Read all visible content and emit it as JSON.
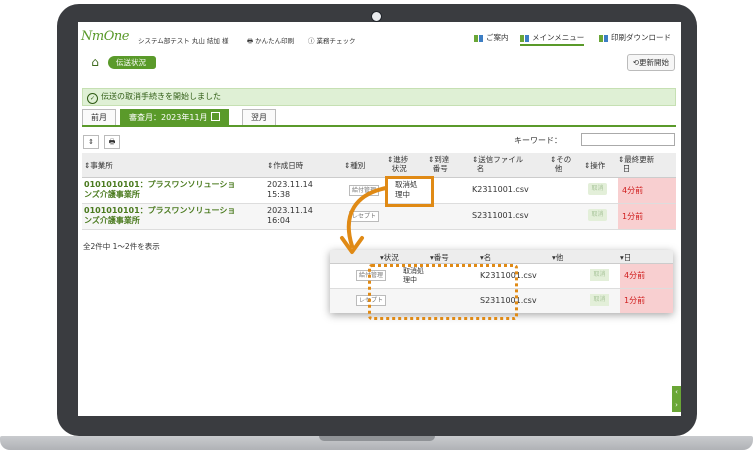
{
  "header": {
    "logo_text": "NmOne",
    "user_info": "システム部テスト 丸山 結加 様",
    "easy_print": "かんたん印刷",
    "task_check": "業務チェック",
    "nav": [
      "ご案内",
      "メインメニュー",
      "印刷ダウンロード"
    ]
  },
  "breadcrumb": {
    "label": "伝送状況"
  },
  "refresh_button": "更新開始",
  "notice": "伝送の取消手続きを開始しました",
  "tabs": {
    "prev": "前月",
    "current": "審査月：2023年11月",
    "next": "翌月"
  },
  "keyword": {
    "label": "キーワード：",
    "value": ""
  },
  "table": {
    "headers": {
      "office": "事業所",
      "created": "作成日時",
      "type": "種別",
      "progress_1": "進捗",
      "progress_2": "状況",
      "arrival_1": "到達",
      "arrival_2": "番号",
      "file_1": "送信ファイル",
      "file_2": "名",
      "other_1": "その",
      "other_2": "他",
      "action": "操作",
      "updated_1": "最終更新",
      "updated_2": "日"
    },
    "rows": [
      {
        "office_1": "0101010101：プラスワンソリューショ",
        "office_2": "ンズ介護事業所",
        "date_1": "2023.11.14",
        "date_2": "15:38",
        "type": "給付管理",
        "status_1": "取消処",
        "status_2": "理中",
        "file": "K2311001.csv",
        "cancel": "取消",
        "updated": "4分前"
      },
      {
        "office_1": "0101010101：プラスワンソリューショ",
        "office_2": "ンズ介護事業所",
        "date_1": "2023.11.14",
        "date_2": "16:04",
        "type": "レセプト",
        "status_1": "",
        "status_2": "",
        "file": "S2311001.csv",
        "cancel": "取消",
        "updated": "1分前"
      }
    ],
    "count_text": "全2件中 1～2件を表示"
  },
  "zoom": {
    "headers": {
      "status": "状況",
      "arrival": "番号",
      "file": "名",
      "other": "他",
      "updated": "日"
    },
    "rows": [
      {
        "type": "給付管理",
        "status_1": "取消処",
        "status_2": "理中",
        "file": "K2311001.csv",
        "cancel": "取消",
        "updated": "4分前"
      },
      {
        "type": "レセプト",
        "status_1": "",
        "status_2": "",
        "file": "S2311001.csv",
        "cancel": "取消",
        "updated": "1分前"
      }
    ]
  },
  "colors": {
    "brand_green": "#5a9a2a",
    "highlight_orange": "#e08a15",
    "updated_red": "#d02020"
  }
}
